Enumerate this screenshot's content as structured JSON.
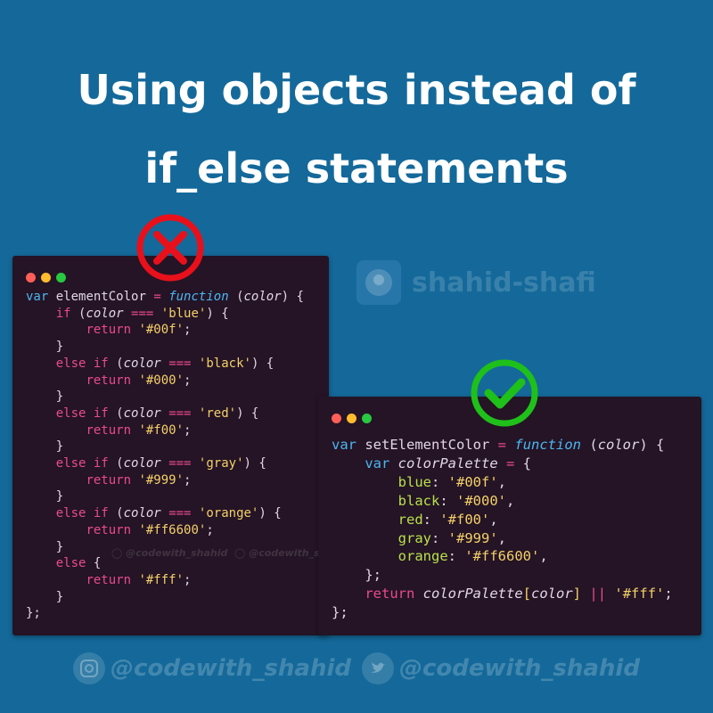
{
  "title": {
    "line1": "Using objects instead of",
    "line2": "if_else statements"
  },
  "watermark": {
    "brand": "shahid-shafi",
    "handle": "@codewith_shahid"
  },
  "badges": {
    "bad_icon": "x-circle-icon",
    "good_icon": "check-circle-icon",
    "bad_color": "#e8101b",
    "good_color": "#1fc01a"
  },
  "colors": {
    "background": "#14699a",
    "panel": "#241425",
    "keyword": "#4cb6f0",
    "control": "#e94a90",
    "string": "#f5d06a",
    "key": "#b9e04c"
  },
  "social": {
    "instagram_icon": "instagram-icon",
    "twitter_icon": "twitter-icon",
    "instagram_handle": "@codewith_shahid",
    "twitter_handle": "@codewith_shahid"
  },
  "bad_code": {
    "kw_var": "var",
    "fn_name": "elementColor",
    "eq": "=",
    "kw_function": "function",
    "param": "color",
    "cases": [
      {
        "value": "'blue'",
        "result": "'#00f'"
      },
      {
        "value": "'black'",
        "result": "'#000'"
      },
      {
        "value": "'red'",
        "result": "'#f00'"
      },
      {
        "value": "'gray'",
        "result": "'#999'"
      },
      {
        "value": "'orange'",
        "result": "'#ff6600'"
      }
    ],
    "kw_if": "if",
    "kw_else": "else",
    "kw_return": "return",
    "strict_eq": "===",
    "default_result": "'#fff'"
  },
  "good_code": {
    "kw_var": "var",
    "fn_name": "setElementColor",
    "eq": "=",
    "kw_function": "function",
    "param": "color",
    "obj_name": "colorPalette",
    "entries": [
      {
        "key": "blue",
        "value": "'#00f'"
      },
      {
        "key": "black",
        "value": "'#000'"
      },
      {
        "key": "red",
        "value": "'#f00'"
      },
      {
        "key": "gray",
        "value": "'#999'"
      },
      {
        "key": "orange",
        "value": "'#ff6600'"
      }
    ],
    "kw_return": "return",
    "or_op": "||",
    "default_result": "'#fff'"
  }
}
